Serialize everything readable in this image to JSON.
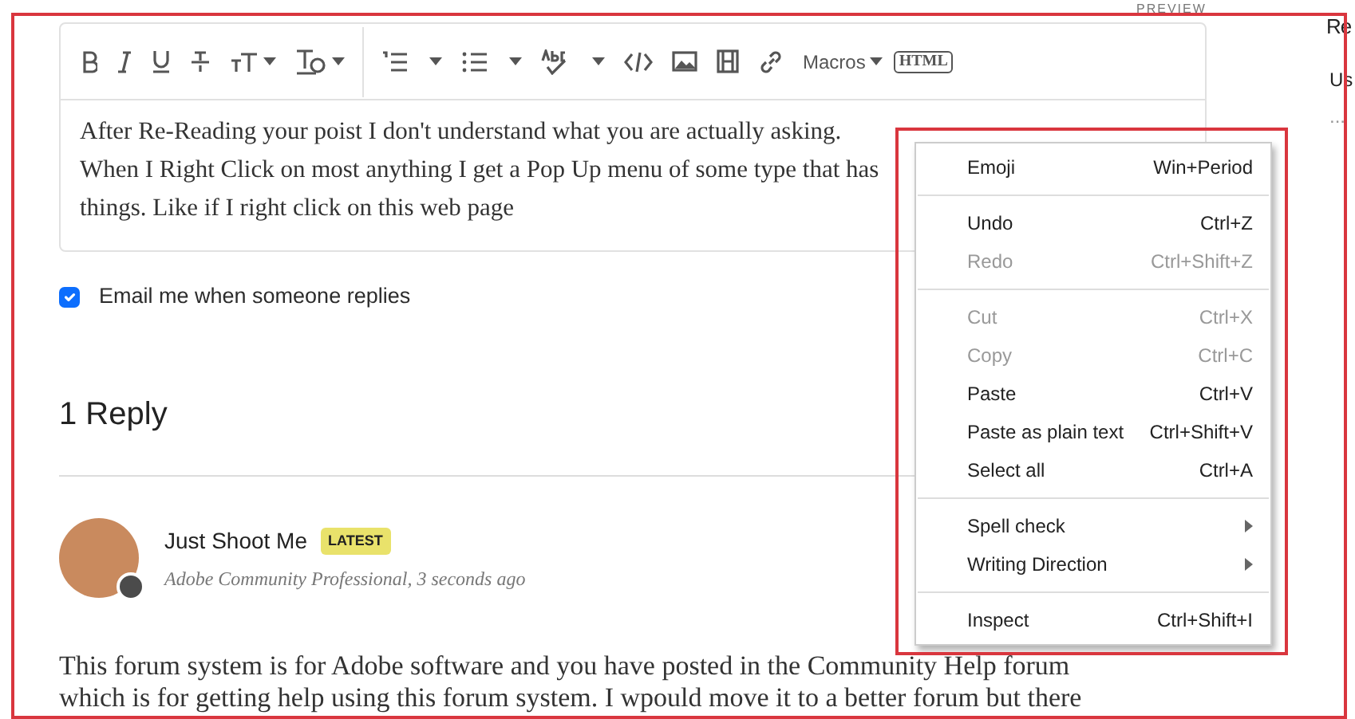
{
  "side_panel": {
    "preview_label": "PREVIEW",
    "heading": "Re",
    "subtext": "Us",
    "dots": "..."
  },
  "editor": {
    "toolbar": [
      {
        "kind": "bold"
      },
      {
        "kind": "italic"
      },
      {
        "kind": "underline"
      },
      {
        "kind": "strike"
      },
      {
        "kind": "textsize",
        "caret": true
      },
      {
        "kind": "clearformat",
        "caret": true
      },
      {
        "kind": "divider"
      },
      {
        "kind": "orderedlist",
        "caret": true
      },
      {
        "kind": "bulletlist",
        "caret": true
      },
      {
        "kind": "spellcheck",
        "caret": true
      },
      {
        "kind": "code"
      },
      {
        "kind": "image"
      },
      {
        "kind": "video"
      },
      {
        "kind": "link"
      },
      {
        "kind": "menu",
        "label": "Macros",
        "caret": true
      },
      {
        "kind": "html",
        "label": "HTML"
      }
    ],
    "lines": [
      "After Re-Reading your poist I don't understand what you are actually asking.",
      "When I Right Click on most anything I get a Pop Up menu of some type that has",
      "things. Like if I right click on this web page"
    ]
  },
  "email_option": {
    "label": "Email me when someone replies",
    "checked": true
  },
  "replies_heading": "1 Reply",
  "reply": {
    "author": "Just Shoot Me",
    "badge": "LATEST",
    "role": "Adobe Community Professional",
    "time": ", 3 seconds ago",
    "body": [
      "This forum system is for Adobe software and you have posted in the Community Help forum",
      "which is for getting help using this forum system. I wpould move it to a better forum but there"
    ]
  },
  "context_menu": [
    [
      {
        "label": "Emoji",
        "shortcut": "Win+Period",
        "disabled": false,
        "submenu": false
      }
    ],
    [
      {
        "label": "Undo",
        "shortcut": "Ctrl+Z",
        "disabled": false,
        "submenu": false
      },
      {
        "label": "Redo",
        "shortcut": "Ctrl+Shift+Z",
        "disabled": true,
        "submenu": false
      }
    ],
    [
      {
        "label": "Cut",
        "shortcut": "Ctrl+X",
        "disabled": true,
        "submenu": false
      },
      {
        "label": "Copy",
        "shortcut": "Ctrl+C",
        "disabled": true,
        "submenu": false
      },
      {
        "label": "Paste",
        "shortcut": "Ctrl+V",
        "disabled": false,
        "submenu": false
      },
      {
        "label": "Paste as plain text",
        "shortcut": "Ctrl+Shift+V",
        "disabled": false,
        "submenu": false
      },
      {
        "label": "Select all",
        "shortcut": "Ctrl+A",
        "disabled": false,
        "submenu": false
      }
    ],
    [
      {
        "label": "Spell check",
        "disabled": false,
        "submenu": true
      },
      {
        "label": "Writing Direction",
        "disabled": false,
        "submenu": true
      }
    ],
    [
      {
        "label": "Inspect",
        "shortcut": "Ctrl+Shift+I",
        "disabled": false,
        "submenu": false
      }
    ]
  ]
}
